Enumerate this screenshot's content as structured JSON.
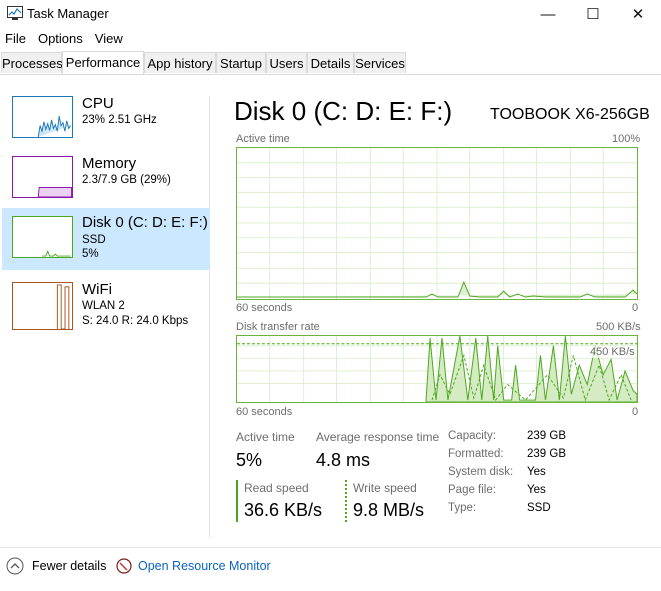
{
  "window": {
    "title": "Task Manager",
    "minimize": "—",
    "maximize": "☐",
    "close": "✕"
  },
  "menu": [
    "File",
    "Options",
    "View"
  ],
  "tabs": [
    "Processes",
    "Performance",
    "App history",
    "Startup",
    "Users",
    "Details",
    "Services"
  ],
  "active_tab": "Performance",
  "sidebar": [
    {
      "name": "CPU",
      "line1": "23%  2.51 GHz",
      "line2": "",
      "color": "#1a7ab8"
    },
    {
      "name": "Memory",
      "line1": "2.3/7.9 GB (29%)",
      "line2": "",
      "color": "#8b17a8"
    },
    {
      "name": "Disk 0 (C: D: E: F:)",
      "line1": "SSD",
      "line2": "5%",
      "color": "#4da81f"
    },
    {
      "name": "WiFi",
      "line1": "WLAN 2",
      "line2": "S: 24.0  R: 24.0 Kbps",
      "color": "#a8571c"
    }
  ],
  "main": {
    "title": "Disk 0 (C: D: E: F:)",
    "model": "TOOBOOK X6-256GB",
    "graph1": {
      "label": "Active time",
      "max": "100%",
      "time": "60 seconds",
      "min": "0"
    },
    "graph2": {
      "label": "Disk transfer rate",
      "max": "500 KB/s",
      "mid": "450 KB/s",
      "time": "60 seconds",
      "min": "0"
    },
    "stats": {
      "active_time_label": "Active time",
      "active_time_value": "5%",
      "avg_response_label": "Average response time",
      "avg_response_value": "4.8 ms",
      "read_label": "Read speed",
      "read_value": "36.6 KB/s",
      "write_label": "Write speed",
      "write_value": "9.8 MB/s"
    },
    "details": [
      {
        "key": "Capacity:",
        "value": "239 GB"
      },
      {
        "key": "Formatted:",
        "value": "239 GB"
      },
      {
        "key": "System disk:",
        "value": "Yes"
      },
      {
        "key": "Page file:",
        "value": "Yes"
      },
      {
        "key": "Type:",
        "value": "SSD"
      }
    ]
  },
  "footer": {
    "fewer_details": "Fewer details",
    "resource_monitor": "Open Resource Monitor"
  },
  "colors": {
    "accent_green": "#6db33f",
    "selected_bg": "#cce8ff",
    "link": "#0b62c4"
  }
}
